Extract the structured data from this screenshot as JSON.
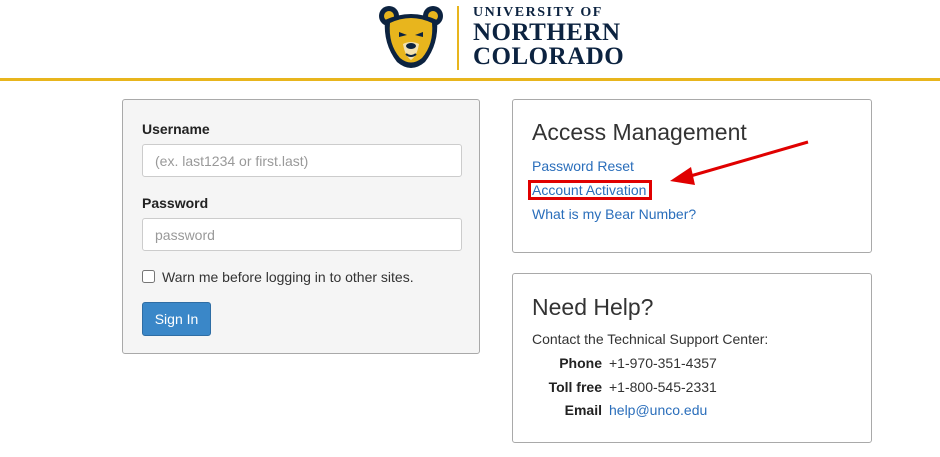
{
  "brand": {
    "line1": "UNIVERSITY OF",
    "line2": "NORTHERN",
    "line3": "COLORADO",
    "colors": {
      "navy": "#0c2340",
      "gold": "#e8b51d"
    }
  },
  "login": {
    "username_label": "Username",
    "username_placeholder": "(ex. last1234 or first.last)",
    "password_label": "Password",
    "password_placeholder": "password",
    "warn_label": "Warn me before logging in to other sites.",
    "sign_in_label": "Sign In"
  },
  "access": {
    "title": "Access Management",
    "links": [
      "Password Reset",
      "Account Activation",
      "What is my Bear Number?"
    ]
  },
  "help": {
    "title": "Need Help?",
    "intro": "Contact the Technical Support Center:",
    "contacts": [
      {
        "label": "Phone",
        "value": "+1-970-351-4357"
      },
      {
        "label": "Toll free",
        "value": "+1-800-545-2331"
      },
      {
        "label": "Email",
        "value": "help@unco.edu"
      }
    ]
  },
  "annotation_color": "#e00000",
  "link_color": "#2a6ebb",
  "button_color": "#3a87c8"
}
